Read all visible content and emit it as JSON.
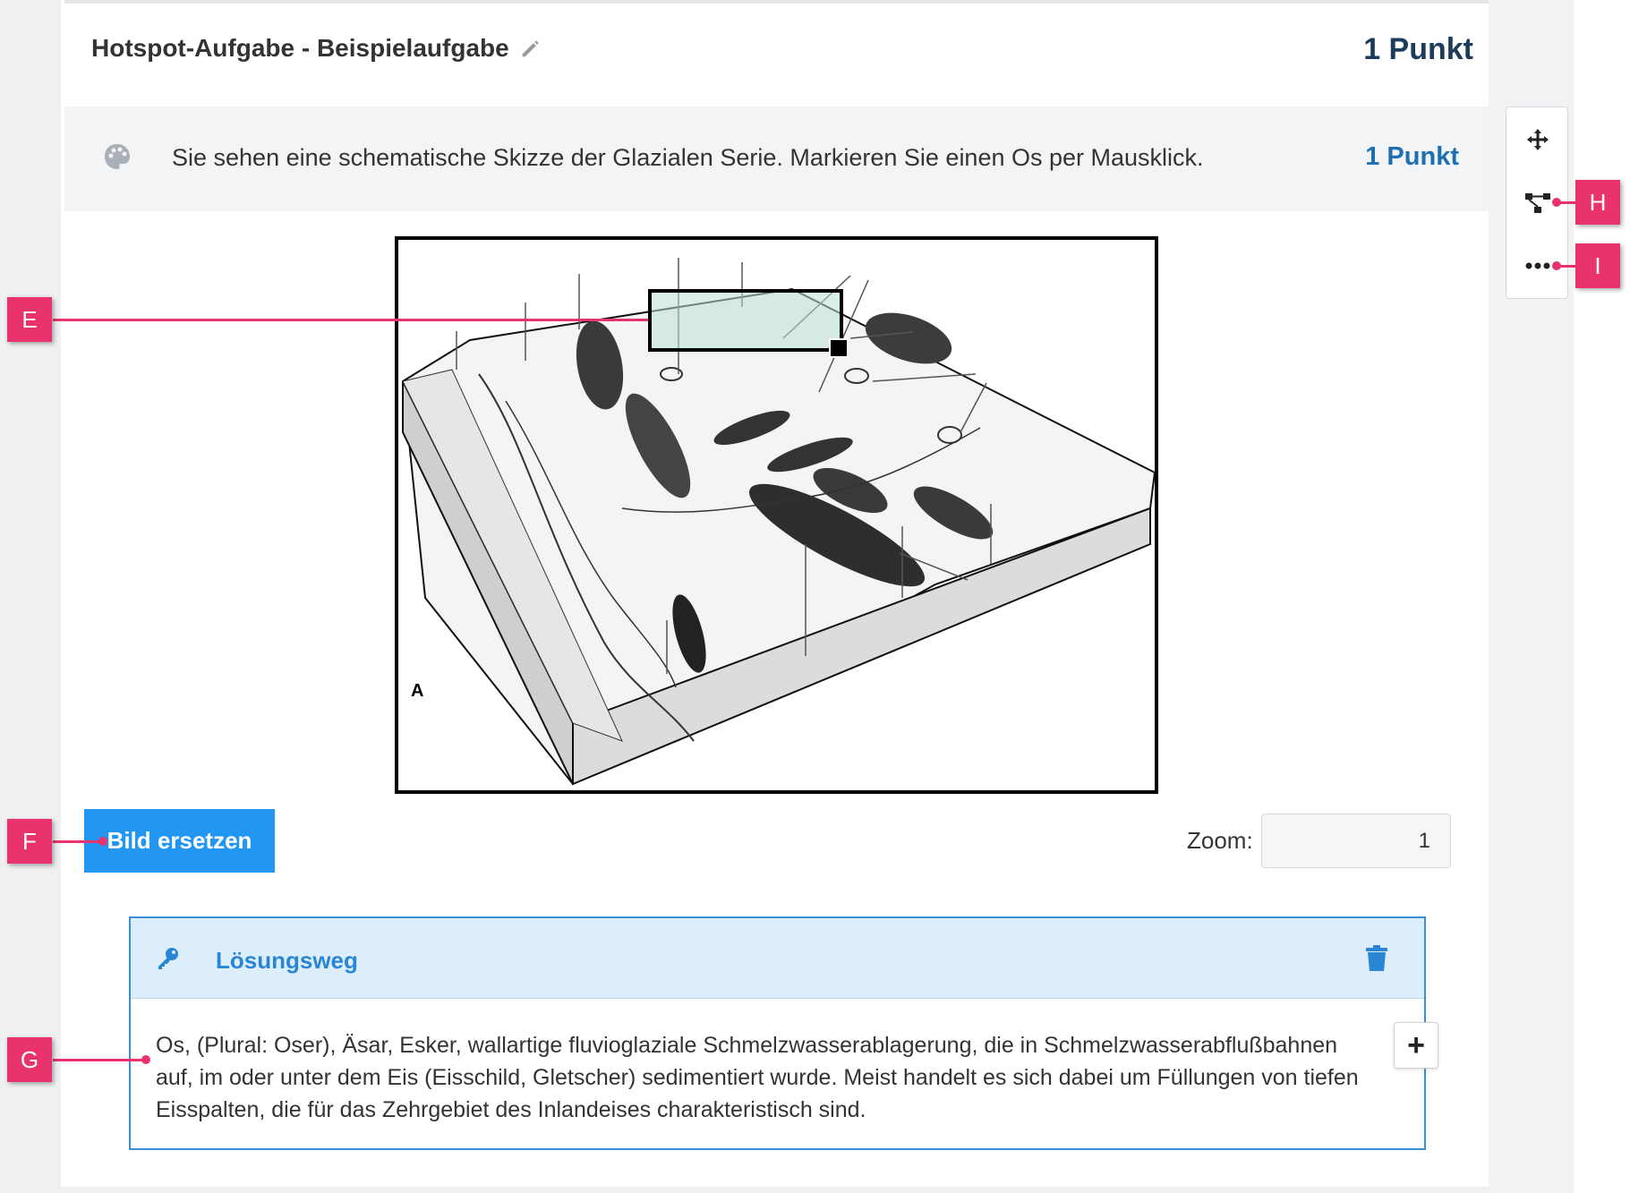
{
  "task": {
    "title": "Hotspot-Aufgabe - Beispielaufgabe",
    "points": "1 Punkt"
  },
  "question": {
    "text": "Sie sehen eine schematische Skizze der Glazialen Serie. Markieren Sie einen Os per Mausklick.",
    "points": "1 Punkt"
  },
  "image": {
    "corner_label": "A"
  },
  "actions": {
    "replace_image_label": "Bild ersetzen",
    "zoom_label": "Zoom:",
    "zoom_value": "1"
  },
  "solution": {
    "title": "Lösungsweg",
    "text": "Os, (Plural: Oser), Äsar, Esker, wallartige fluvioglaziale Schmelzwasserablagerung, die in Schmelzwasserabflußbahnen auf, im oder unter dem Eis (Eisschild, Gletscher) sedimentiert wurde. Meist handelt es sich dabei um Füllungen von tiefen Eisspalten, die für das Zehrgebiet des Inlandeises charakteristisch sind.",
    "add_label": "+"
  },
  "toolbar": {
    "icons": [
      "move-icon",
      "hierarchy-icon",
      "more-icon"
    ]
  },
  "callouts": {
    "e": "E",
    "f": "F",
    "g": "G",
    "h": "H",
    "i": "I"
  },
  "colors": {
    "accent": "#2196f3",
    "callout": "#e8336d",
    "points_dark": "#1d3b5a",
    "points_blue": "#1e6fb0",
    "solution_head": "#dcedfb"
  }
}
